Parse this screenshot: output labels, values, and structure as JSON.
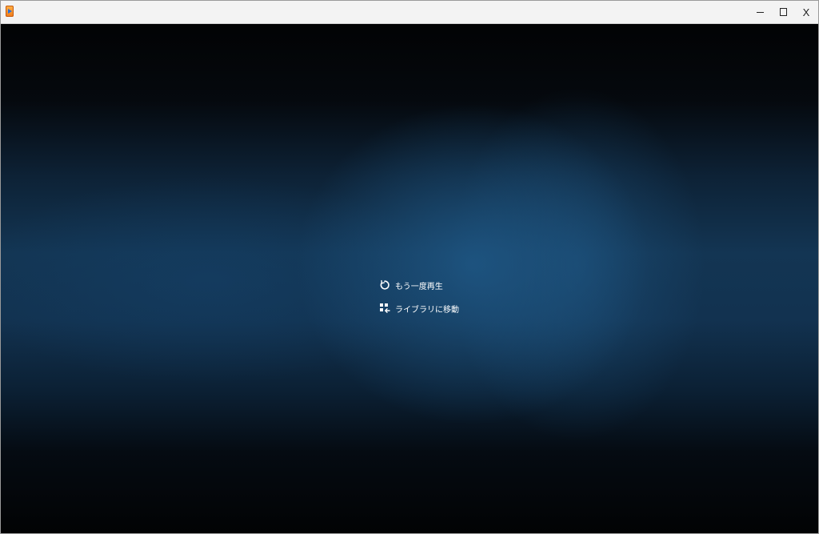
{
  "window": {
    "app_icon": "media-player-app-icon",
    "controls": {
      "minimize_icon": "minimize-icon",
      "maximize_icon": "maximize-icon",
      "close_label": "X"
    }
  },
  "player": {
    "background_accent": "#133553",
    "menu": [
      {
        "icon": "replay-icon",
        "label": "もう一度再生"
      },
      {
        "icon": "library-icon",
        "label": "ライブラリに移動"
      }
    ]
  }
}
